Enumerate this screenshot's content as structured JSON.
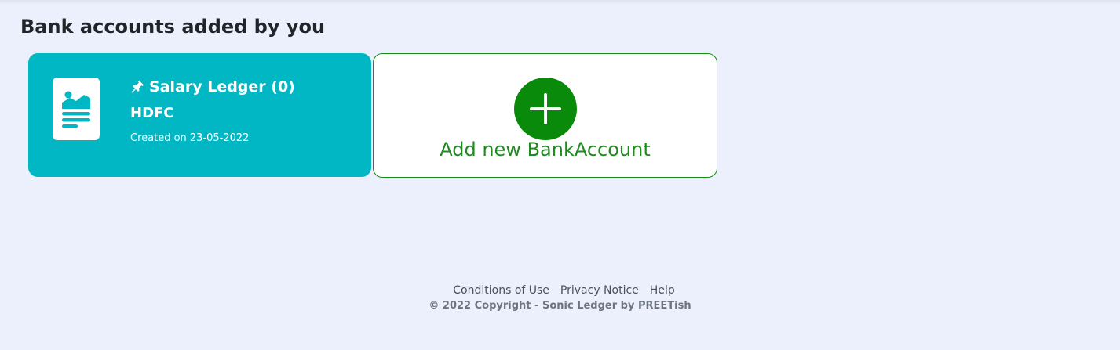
{
  "page": {
    "title": "Bank accounts added by you"
  },
  "accounts": [
    {
      "name": "Salary Ledger (0)",
      "bank": "HDFC",
      "created": "Created on 23-05-2022",
      "icon": "document-icon",
      "pinned_icon": "pin-icon",
      "color": "#00b7c3"
    }
  ],
  "add_card": {
    "label": "Add new BankAccount",
    "icon": "plus-icon",
    "color": "#0a8a0a"
  },
  "footer": {
    "links": [
      "Conditions of Use",
      "Privacy Notice",
      "Help"
    ],
    "copyright": "© 2022 Copyright - Sonic Ledger by PREETish"
  }
}
